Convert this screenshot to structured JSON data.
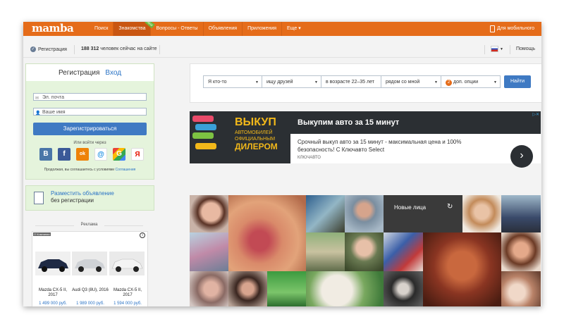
{
  "colors": {
    "brand": "#e56c1a",
    "link": "#2a73c5",
    "button": "#3f7ac3",
    "panel": "#e5f4dc"
  },
  "topbar": {
    "logo": "mamba",
    "nav": [
      {
        "label": "Поиск"
      },
      {
        "label": "Знакомства",
        "badge": "NEW"
      },
      {
        "label": "Вопросы - Ответы"
      },
      {
        "label": "Объявления"
      },
      {
        "label": "Приложения"
      },
      {
        "label": "Еще ▾"
      }
    ],
    "mobile": "Для мобильного"
  },
  "status": {
    "register": "Регистрация",
    "online_count": "188 312",
    "online_text": "человек сейчас на сайте",
    "lang_icon": "flag-ru",
    "help": "Помощь"
  },
  "auth": {
    "tab_register": "Регистрация",
    "tab_login": "Вход",
    "email_placeholder": "Эл. почта",
    "name_placeholder": "Ваше имя",
    "submit": "Зарегистрироваться",
    "via": "Или войти через",
    "socials": [
      "В",
      "f",
      "ok",
      "@",
      "G",
      "Я"
    ],
    "terms": "Продолжая, вы соглашаетесь с условиями",
    "terms_link": "Соглашения"
  },
  "post_ad": {
    "line1": "Разместить объявление",
    "line2": "без регистрации"
  },
  "ads": {
    "label": "Реклама",
    "brand": "О Компании",
    "cars": [
      {
        "name": "Mazda CX-5 II, 2017",
        "price": "1 499 000 руб."
      },
      {
        "name": "Audi Q3 (8U), 2016",
        "price": "1 989 000 руб."
      },
      {
        "name": "Mazda CX-5 II, 2017",
        "price": "1 594 000 руб."
      }
    ]
  },
  "search": {
    "who": "Я кто-то",
    "seek": "ищу друзей",
    "age": "в возрасте 22–35 лет",
    "where": "рядом со мной",
    "options_count": "2",
    "options": "доп. опции",
    "find": "Найти"
  },
  "banner": {
    "img_title": "ВЫКУП",
    "img_sub": "АВТОМОБИЛЕЙ ОФИЦИАЛЬНЫМ",
    "img_dealer": "ДИЛЕРОМ",
    "headline": "Выкупим авто за 15 минут",
    "desc": "Срочный выкуп авто за 15 минут - максимальная цена и 100% безопасность! С Ключавто Select",
    "source": "КЛЮЧАВТО"
  },
  "grid": {
    "new_faces": "Новые лица"
  }
}
